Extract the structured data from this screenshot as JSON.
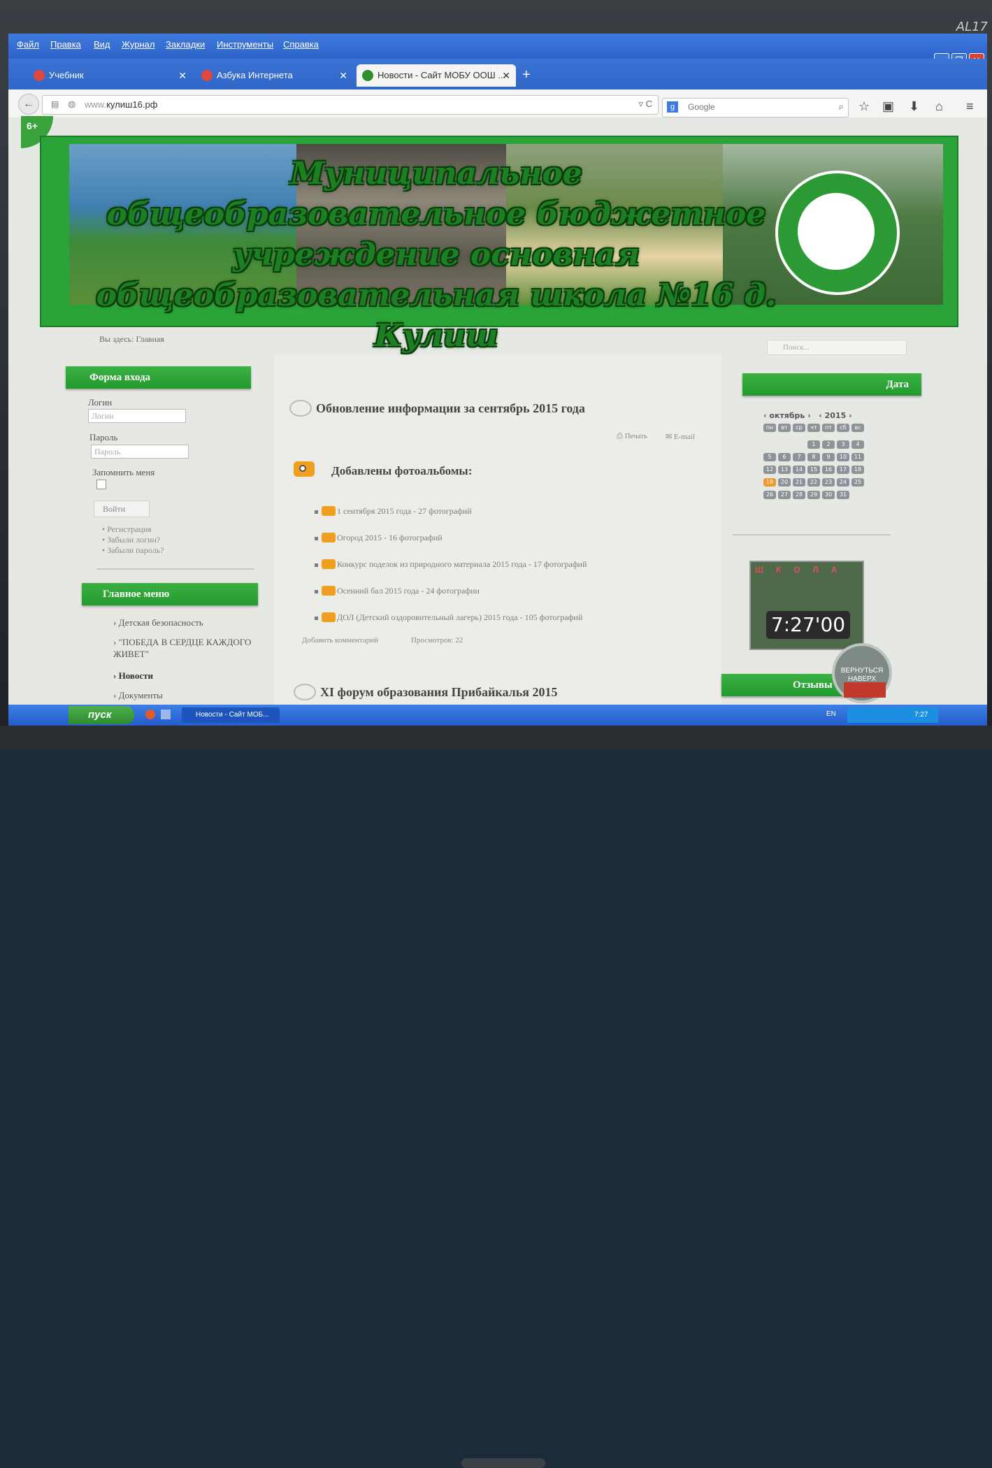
{
  "monitor": {
    "model": "AL17"
  },
  "menubar": [
    "Файл",
    "Правка",
    "Вид",
    "Журнал",
    "Закладки",
    "Инструменты",
    "Справка"
  ],
  "tabs": [
    {
      "label": "Учебник"
    },
    {
      "label": "Азбука Интернета"
    },
    {
      "label": "Новости - Сайт МОБУ ООШ ..."
    }
  ],
  "navbar": {
    "url_prefix": "www.",
    "url_main": "кулиш16.рф",
    "search_placeholder": "Google"
  },
  "page": {
    "age_badge": "6+",
    "banner_title": "Муниципальное общеобразовательное бюджетное учреждение основная общеобразовательная школа №16 д. Кулиш",
    "breadcrumb_label": "Вы здесь:",
    "breadcrumb_current": "Главная",
    "search_placeholder": "Поиск..."
  },
  "login": {
    "header": "Форма входа",
    "login_label": "Логин",
    "login_placeholder": "Логин",
    "password_label": "Пароль",
    "password_placeholder": "Пароль",
    "remember_label": "Запомнить меня",
    "submit": "Войти",
    "links": [
      "Регистрация",
      "Забыли логин?",
      "Забыли пароль?"
    ]
  },
  "main_menu": {
    "header": "Главное меню",
    "items": [
      "Детская безопасность",
      "\"ПОБЕДА В СЕРДЦЕ КАЖДОГО ЖИВЕТ\"",
      "Новости",
      "Документы"
    ]
  },
  "article": {
    "title": "Обновление информации за сентябрь 2015 года",
    "print_label": "Печать",
    "email_label": "E-mail",
    "albums_heading": "Добавлены фотоальбомы:",
    "albums": [
      "1 сентября 2015 года - 27 фотографий",
      "Огород 2015 - 16 фотографий",
      "Конкурс поделок из природного материала 2015 года - 17 фотографий",
      "Осенний бал 2015 года - 24 фотографии",
      "ДОЛ (Детский оздоровительный лагерь) 2015 года - 105 фотографий"
    ],
    "add_comment": "Добавить комментарий",
    "views": "Просмотров: 22",
    "next_title": "XI форум образования Прибайкалья 2015"
  },
  "date_module": {
    "header": "Дата",
    "month": "октябрь",
    "year": "2015",
    "weekdays": [
      "пн",
      "вт",
      "ср",
      "чт",
      "пт",
      "сб",
      "вс"
    ],
    "days": [
      "1",
      "2",
      "3",
      "4",
      "5",
      "6",
      "7",
      "8",
      "9",
      "10",
      "11",
      "12",
      "13",
      "14",
      "15",
      "16",
      "17",
      "18",
      "19",
      "20",
      "21",
      "22",
      "23",
      "24",
      "25",
      "26",
      "27",
      "28",
      "29",
      "30",
      "31"
    ],
    "today": "19"
  },
  "timer": {
    "sign": "ШКОЛА",
    "time": "7:27'00"
  },
  "feedback": {
    "header": "Отзывы о"
  },
  "to_top": {
    "label": "ВЕРНУТЬСЯ НАВЕРХ"
  },
  "taskbar": {
    "start": "пуск",
    "task": "Новости - Сайт МОБ...",
    "lang": "EN",
    "time": "7:27"
  },
  "colors": {
    "brand_green": "#2aa339",
    "taskbar_blue": "#245ccc",
    "accent_orange": "#f09a30"
  }
}
